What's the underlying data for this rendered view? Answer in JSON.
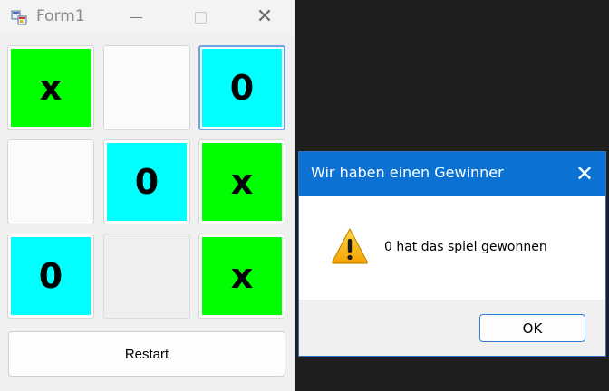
{
  "form": {
    "title": "Form1",
    "close_glyph": "✕",
    "cells": [
      "x",
      "",
      "0",
      "",
      "0",
      "x",
      "0",
      "",
      "x"
    ],
    "restart_label": "Restart"
  },
  "dialog": {
    "title": "Wir haben einen Gewinner",
    "close_glyph": "✕",
    "message": "0 hat das spiel gewonnen",
    "ok_label": "OK",
    "icon": "warning-icon"
  },
  "colors": {
    "x_cell": "#00ff00",
    "o_cell": "#00ffff",
    "dialog_titlebar": "#0b72d4"
  }
}
